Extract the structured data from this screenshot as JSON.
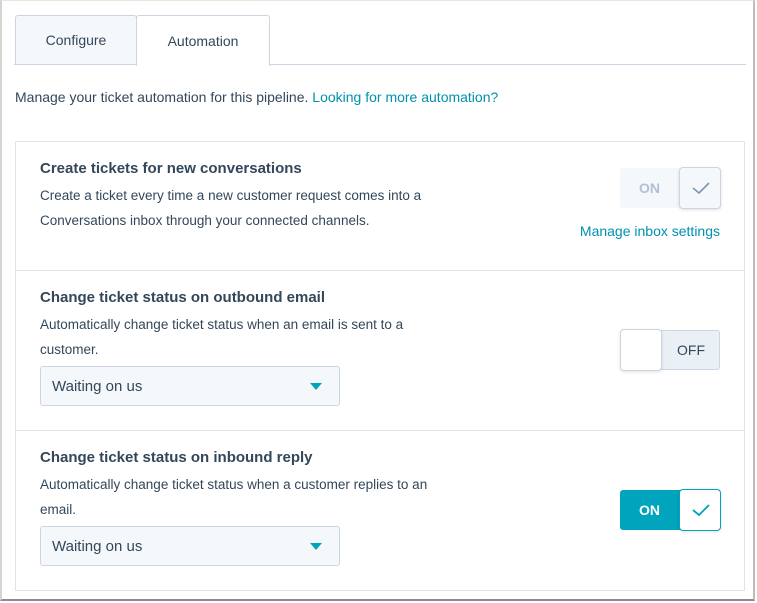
{
  "tabs": [
    {
      "label": "Configure",
      "active": false
    },
    {
      "label": "Automation",
      "active": true
    }
  ],
  "intro": {
    "text": "Manage your ticket automation for this pipeline.",
    "link": "Looking for more automation?"
  },
  "automations": [
    {
      "title": "Create tickets for new conversations",
      "description": "Create a ticket every time a new customer request comes into a Conversations inbox through your connected channels.",
      "toggle_state": "on",
      "toggle_disabled": true,
      "toggle_label": "ON",
      "link": "Manage inbox settings"
    },
    {
      "title": "Change ticket status on outbound email",
      "description": "Automatically change ticket status when an email is sent to a customer.",
      "select_value": "Waiting on us",
      "toggle_state": "off",
      "toggle_label": "OFF"
    },
    {
      "title": "Change ticket status on inbound reply",
      "description": "Automatically change ticket status when a customer replies to an email.",
      "select_value": "Waiting on us",
      "toggle_state": "on",
      "toggle_label": "ON"
    }
  ],
  "icons": {
    "check": "check-icon",
    "caret": "caret-down-icon"
  },
  "colors": {
    "accent": "#00a4bd",
    "link": "#0091ae",
    "text": "#33475b",
    "border": "#cbd6e2"
  }
}
